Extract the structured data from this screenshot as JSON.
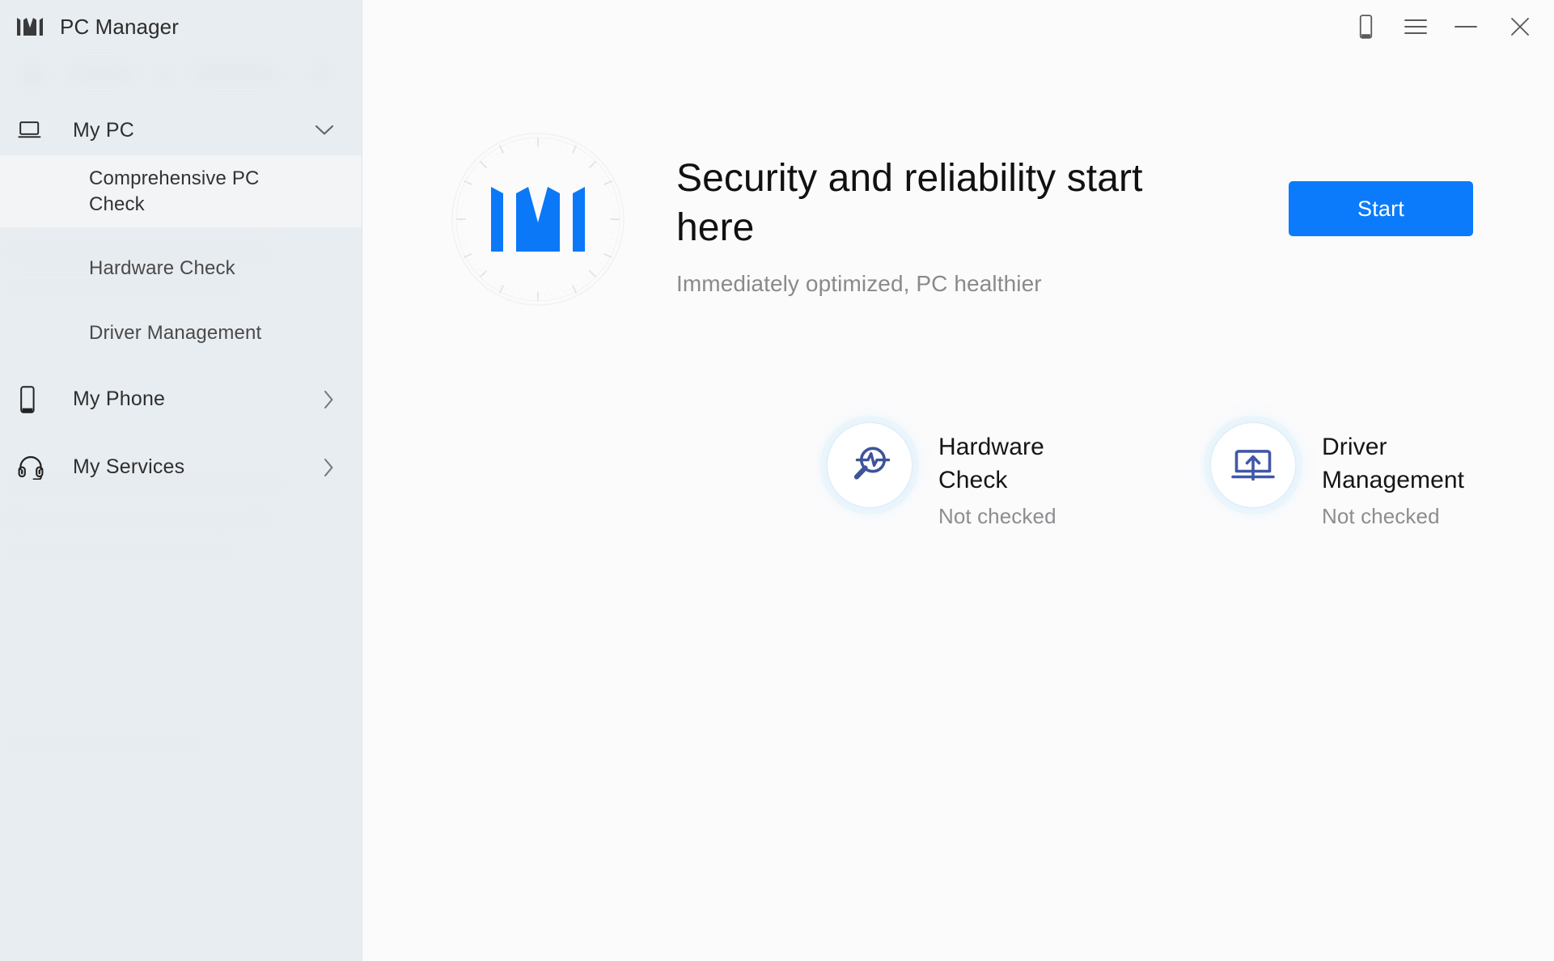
{
  "window": {
    "app_title": "PC Manager",
    "logo_icon": "pcmanager-m-logo-icon",
    "titlebar_buttons": [
      {
        "name": "phone-icon",
        "label": "My Phone"
      },
      {
        "name": "hamburger-menu-icon",
        "label": "Menu"
      },
      {
        "name": "minimize-icon",
        "label": "Minimize"
      },
      {
        "name": "close-icon",
        "label": "Close"
      }
    ]
  },
  "sidebar": {
    "background_color": "#E8EDF1",
    "groups": [
      {
        "label": "My PC",
        "icon": "laptop-icon",
        "expander_icon": "chevron-down-icon",
        "expanded": true,
        "items": [
          {
            "label": "Comprehensive PC Check",
            "active": true
          },
          {
            "label": "Hardware Check",
            "active": false
          },
          {
            "label": "Driver Management",
            "active": false
          }
        ]
      },
      {
        "label": "My Phone",
        "icon": "phone-icon",
        "expander_icon": "chevron-right-icon",
        "expanded": false,
        "items": []
      },
      {
        "label": "My Services",
        "icon": "headset-icon",
        "expander_icon": "chevron-right-icon",
        "expanded": false,
        "items": []
      }
    ]
  },
  "hero": {
    "logo_icon": "pcmanager-m-logo-blue-icon",
    "dial_icon": "dotted-dial-ring-icon",
    "title": "Security and reliability start here",
    "subtitle": "Immediately optimized, PC healthier",
    "start_label": "Start",
    "accent_color": "#0C7BFB"
  },
  "cards": [
    {
      "icon": "magnifier-pulse-icon",
      "title": "Hardware Check",
      "status": "Not checked",
      "icon_color": "#3D5499"
    },
    {
      "icon": "monitor-upload-icon",
      "title": "Driver Management",
      "status": "Not checked",
      "icon_color": "#4158A8"
    }
  ]
}
